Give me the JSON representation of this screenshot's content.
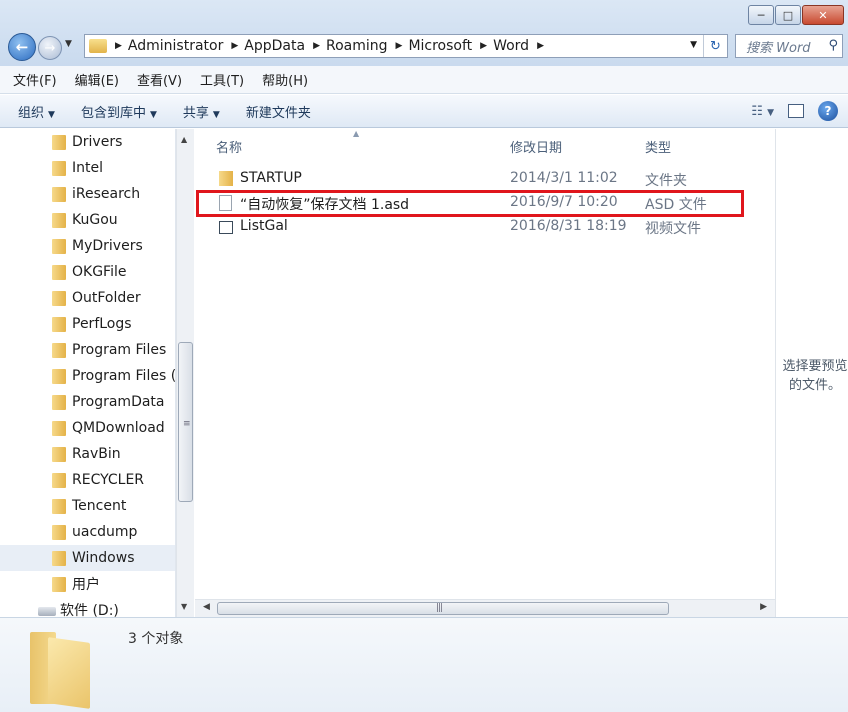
{
  "window": {
    "controls": {
      "minimize": "─",
      "maximize": "□",
      "close": "✕"
    }
  },
  "nav": {
    "back_icon": "back-arrow-icon",
    "forward_icon": "forward-arrow-icon"
  },
  "address": {
    "crumbs": [
      "Administrator",
      "AppData",
      "Roaming",
      "Microsoft",
      "Word"
    ]
  },
  "search": {
    "placeholder": "搜索 Word"
  },
  "menubar": {
    "items": [
      "文件(F)",
      "编辑(E)",
      "查看(V)",
      "工具(T)",
      "帮助(H)"
    ]
  },
  "toolbar": {
    "organize": "组织",
    "include_library": "包含到库中",
    "share": "共享",
    "new_folder": "新建文件夹"
  },
  "sidebar": {
    "items": [
      {
        "label": "Drivers"
      },
      {
        "label": "Intel"
      },
      {
        "label": "iResearch"
      },
      {
        "label": "KuGou"
      },
      {
        "label": "MyDrivers"
      },
      {
        "label": "OKGFile"
      },
      {
        "label": "OutFolder"
      },
      {
        "label": "PerfLogs"
      },
      {
        "label": "Program Files"
      },
      {
        "label": "Program Files ("
      },
      {
        "label": "ProgramData"
      },
      {
        "label": "QMDownload"
      },
      {
        "label": "RavBin"
      },
      {
        "label": "RECYCLER"
      },
      {
        "label": "Tencent"
      },
      {
        "label": "uacdump"
      },
      {
        "label": "Windows"
      },
      {
        "label": "用户"
      },
      {
        "label": "软件 (D:)"
      }
    ],
    "selected": "Windows"
  },
  "filelist": {
    "columns": {
      "name": "名称",
      "date": "修改日期",
      "type": "类型"
    },
    "rows": [
      {
        "name": "STARTUP",
        "date": "2014/3/1 11:02",
        "type": "文件夹"
      },
      {
        "name": "“自动恢复”保存文档 1.asd",
        "date": "2016/9/7 10:20",
        "type": "ASD 文件"
      },
      {
        "name": "ListGal",
        "date": "2016/8/31 18:19",
        "type": "视频文件"
      }
    ],
    "highlight_color": "#e0161c"
  },
  "preview": {
    "text": "选择要预览的文件。"
  },
  "details": {
    "count": "3 个对象"
  }
}
